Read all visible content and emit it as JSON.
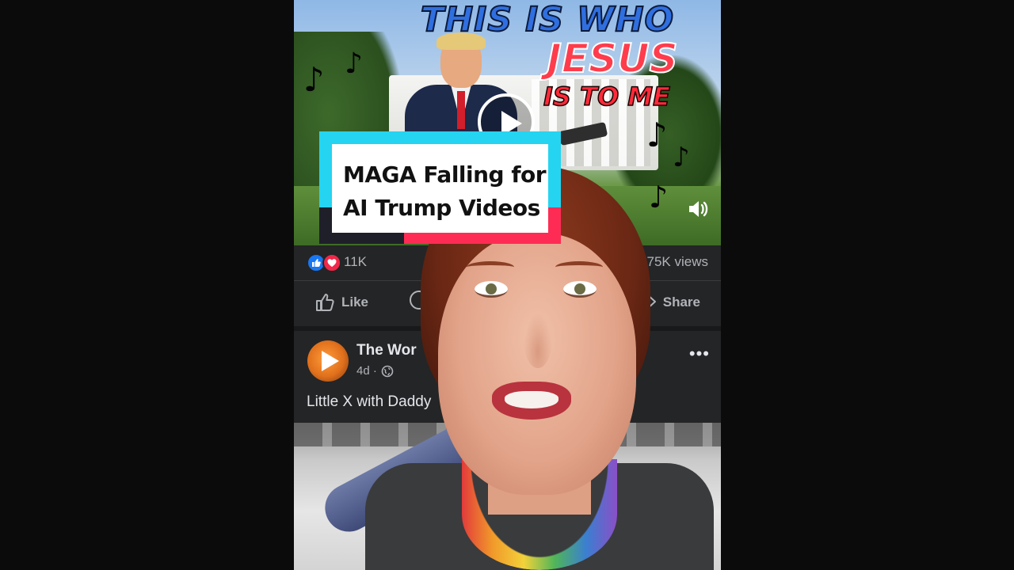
{
  "video_thumbnail": {
    "headline_line1": "THIS IS WHO",
    "headline_line2": "JESUS",
    "headline_line3": "IS TO ME",
    "music_note_glyph": "♪",
    "icons": [
      "play-icon",
      "volume-icon"
    ]
  },
  "title_card": {
    "line1": "MAGA Falling for",
    "line2": "AI Trump Videos"
  },
  "post1_stats": {
    "reaction_count": "11K",
    "views_partial": "s",
    "views": "175K views"
  },
  "post1_actions": {
    "like_label": "Like",
    "share_label": "Share"
  },
  "post2": {
    "page_name": "The Wor",
    "time": "4d ·",
    "more_glyph": "•••",
    "caption": "Little X with Daddy"
  },
  "colors": {
    "facebook_blue": "#1877f2",
    "love_red": "#f02849",
    "tiktok_cyan": "#25d4f0",
    "tiktok_pink": "#fe2c55",
    "dark_surface": "#242526"
  }
}
